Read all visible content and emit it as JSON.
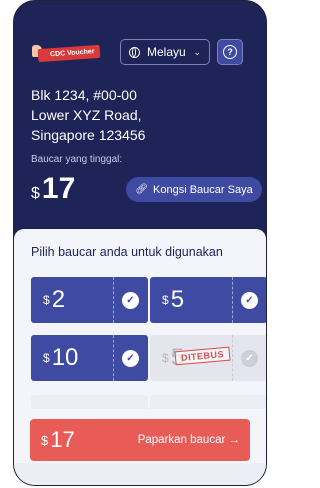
{
  "header": {
    "logo_text": "CDC Voucher",
    "language": "Melayu",
    "help_label": "?"
  },
  "address": {
    "line1": "Blk 1234, #00-00",
    "line2": "Lower XYZ Road,",
    "line3": "Singapore 123456"
  },
  "balance": {
    "label": "Baucar yang tinggal:",
    "currency": "$",
    "amount": "17",
    "share_label": "Kongsi Baucar Saya"
  },
  "picker": {
    "title": "Pilih baucar anda untuk digunakan",
    "vouchers": [
      {
        "currency": "$",
        "value": "2",
        "state": "selected"
      },
      {
        "currency": "$",
        "value": "5",
        "state": "selected"
      },
      {
        "currency": "$",
        "value": "10",
        "state": "selected"
      },
      {
        "currency": "$",
        "value": "5",
        "state": "used",
        "stamp": "DITEBUS"
      }
    ]
  },
  "cta": {
    "currency": "$",
    "amount": "17",
    "label": "Paparkan baucar",
    "arrow": "→"
  },
  "colors": {
    "navy": "#1e2358",
    "accent": "#3f4aa3",
    "cta": "#e85b57"
  }
}
